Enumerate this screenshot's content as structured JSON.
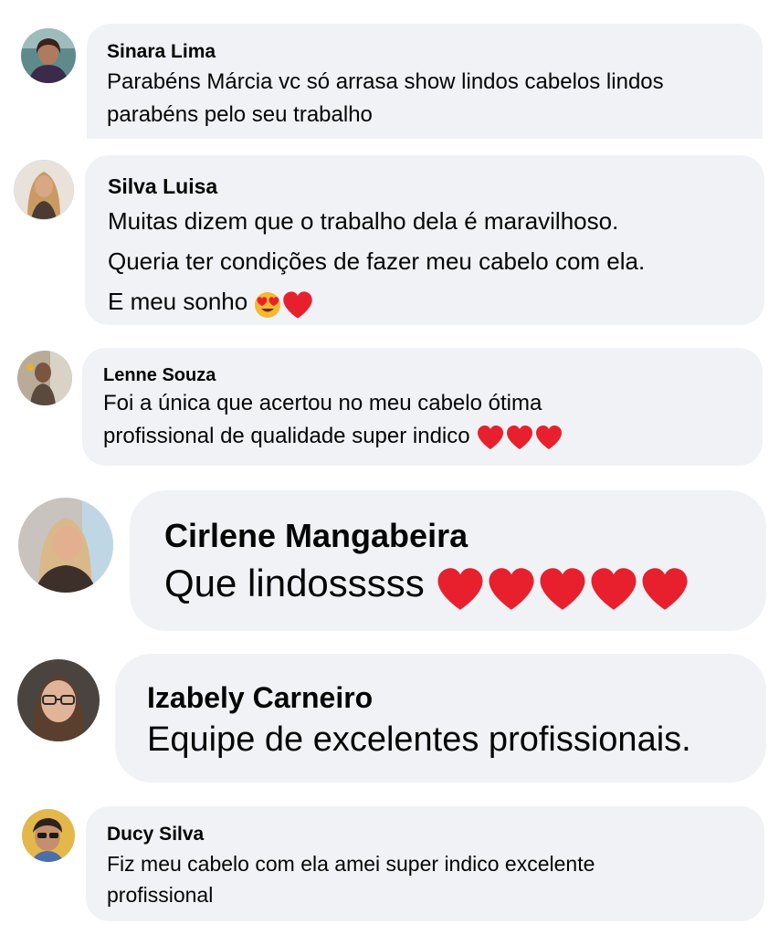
{
  "comments": [
    {
      "name": "Sinara Lima",
      "lines": [
        "Parabéns Márcia vc só arrasa show lindos cabelos lindos",
        "parabéns pelo seu trabalho"
      ]
    },
    {
      "name": "Silva Luisa",
      "lines": [
        "Muitas dizem que o trabalho dela é maravilhoso.",
        "Queria ter condições de fazer meu cabelo com ela.",
        "E meu sonho"
      ]
    },
    {
      "name": "Lenne Souza",
      "lines": [
        "Foi a única que acertou no meu cabelo ótima",
        "profissional de qualidade super indico"
      ]
    },
    {
      "name": "Cirlene Mangabeira",
      "lines": [
        "Que lindosssss"
      ]
    },
    {
      "name": "Izabely Carneiro",
      "lines": [
        "Equipe de excelentes profissionais."
      ]
    },
    {
      "name": "Ducy Silva",
      "lines": [
        "Fiz meu cabelo com ela amei super indico excelente",
        "profissional"
      ]
    }
  ],
  "icons": {
    "heart": "red-heart-emoji",
    "heart_eyes": "heart-eyes-face-emoji"
  },
  "colors": {
    "bubble_bg": "#f0f2f5",
    "text": "#050505",
    "heart": "#e8202e"
  }
}
